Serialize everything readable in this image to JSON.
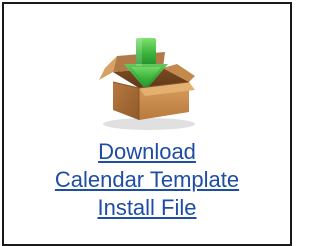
{
  "download": {
    "icon": "download-box-icon",
    "link_lines": [
      "Download",
      "Calendar Template",
      "Install File"
    ],
    "colors": {
      "border": "#1a1a1a",
      "link": "#1e4ea3",
      "arrow": "#3cb33c",
      "box": "#c68b4e"
    }
  }
}
